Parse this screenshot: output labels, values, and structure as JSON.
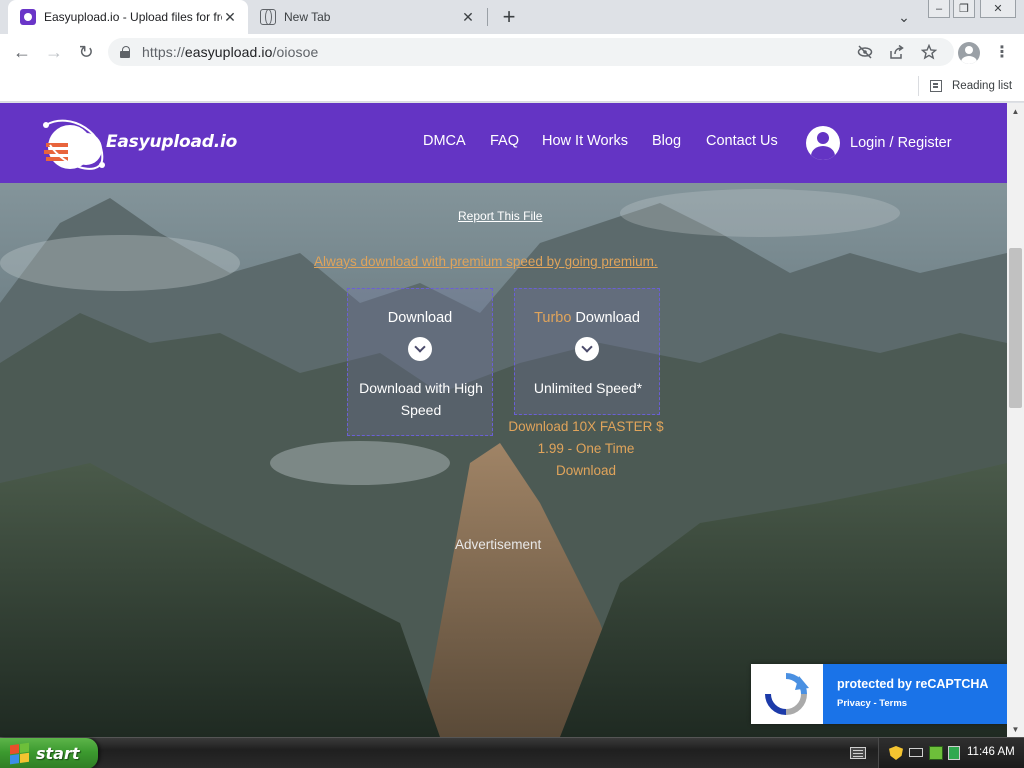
{
  "browser": {
    "tabs": [
      {
        "title": "Easyupload.io - Upload files for free",
        "active": true
      },
      {
        "title": "New Tab",
        "active": false
      }
    ],
    "new_tab_symbol": "+",
    "tab_close_symbol": "✕",
    "tab_search_symbol": "⌄",
    "window_controls": {
      "minimize": "–",
      "maximize": "❐",
      "close": "✕"
    },
    "nav": {
      "back": "←",
      "forward": "→",
      "reload": "↻"
    },
    "address": {
      "scheme": "https://",
      "host": "easyupload.io",
      "path": "/oiosoe"
    },
    "omnibox_icons": [
      "eye-slash-icon",
      "share-icon",
      "star-icon"
    ],
    "menu_symbol": "⋮",
    "bookmarks_bar": {
      "reading_list_label": "Reading list"
    }
  },
  "site": {
    "brand": "Easyupload.io",
    "nav_links": [
      "DMCA",
      "FAQ",
      "How It Works",
      "Blog",
      "Contact Us"
    ],
    "login_label": "Login / Register",
    "report_link": "Report This File",
    "premium_link": "Always download with premium speed by going premium.",
    "download_free": {
      "title": "Download",
      "subtitle": "Download with High Speed"
    },
    "download_turbo": {
      "title_accent": "Turbo",
      "title_rest": " Download",
      "subtitle": "Unlimited Speed*",
      "note": "Download 10X FASTER $ 1.99 - One Time Download"
    },
    "advertisement_label": "Advertisement"
  },
  "recaptcha": {
    "protected_prefix": "protected by ",
    "brand": "reCAPTCHA",
    "links": "Privacy - Terms"
  },
  "scrollbar": {
    "up": "▲",
    "down": "▼"
  },
  "taskbar": {
    "start_label": "start",
    "clock": "11:46 AM"
  },
  "colors": {
    "site_nav": "#6434c4",
    "accent_orange": "#e0a45b",
    "recaptcha_blue": "#1a73e8",
    "start_green": "#3c9a2f"
  }
}
